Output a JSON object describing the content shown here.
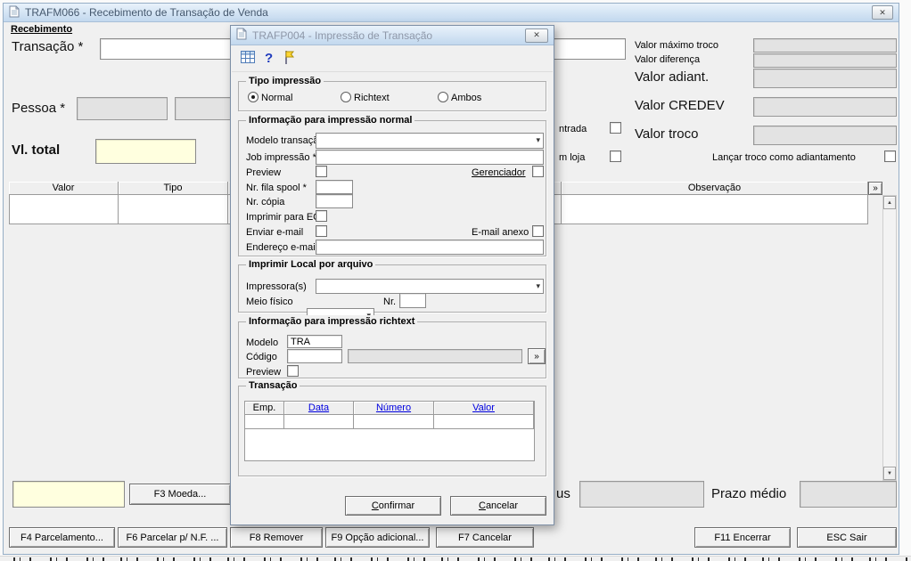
{
  "icons": {
    "close": "✕",
    "dropdown": "▾",
    "scroll_up": "▲",
    "scroll_down": "▼",
    "help": "?"
  },
  "main_window": {
    "title": "TRAFM066 - Recebimento de Transação de Venda",
    "section_label": "Recebimento",
    "fields": {
      "transacao_label": "Transação *",
      "pessoa_label": "Pessoa *",
      "vl_total_label": "Vl. total",
      "valor_maximo_troco_label": "Valor máximo troco",
      "valor_diferenca_label": "Valor diferença",
      "valor_adiant_label": "Valor adiant.",
      "valor_credev_label": "Valor CREDEV",
      "valor_troco_label": "Valor troco",
      "entrada_clipped_label": "ntrada",
      "em_loja_clipped_label": "m loja",
      "lancar_troco_label": "Lançar troco como adiantamento",
      "status_clipped_label": "us",
      "prazo_medio_label": "Prazo médio"
    },
    "table": {
      "columns": [
        "Valor",
        "Tipo",
        "Observação"
      ],
      "expand_button_label": "»"
    },
    "buttons": {
      "f3_moeda": "F3 Moeda...",
      "f4_parcelamento": "F4 Parcelamento...",
      "f6_parcelar": "F6 Parcelar p/ N.F. ...",
      "f8_remover": "F8 Remover",
      "f9_opcao": "F9 Opção adicional...",
      "f7_cancelar": "F7 Cancelar",
      "f11_encerrar": "F11 Encerrar",
      "esc_sair": "ESC Sair"
    }
  },
  "dialog": {
    "title": "TRAFP004 - Impressão de Transação",
    "groups": {
      "tipo_impressao": {
        "legend": "Tipo impressão",
        "radio_normal": "Normal",
        "radio_richtext": "Richtext",
        "radio_ambos": "Ambos",
        "selected_option": "Normal"
      },
      "impressao_normal": {
        "legend": "Informação para impressão normal",
        "modelo_transacao_label": "Modelo transação *",
        "job_impressao_label": "Job impressão *",
        "preview_label": "Preview",
        "gerenciador_label": "Gerenciador",
        "nr_fila_spool_label": "Nr. fila spool *",
        "nr_copia_label": "Nr. cópia",
        "imprimir_ecf_label": "Imprimir para ECF",
        "enviar_email_label": "Enviar e-mail",
        "email_anexo_label": "E-mail anexo",
        "endereco_email_label": "Endereço e-mail"
      },
      "imprimir_local": {
        "legend": "Imprimir Local por arquivo",
        "impressoras_label": "Impressora(s)",
        "meio_fisico_label": "Meio físico",
        "nr_label": "Nr."
      },
      "impressao_richtext": {
        "legend": "Informação para impressão richtext",
        "modelo_label": "Modelo",
        "modelo_value": "TRA",
        "codigo_label": "Código",
        "preview_label": "Preview",
        "expand_button_label": "»"
      },
      "transacao": {
        "legend": "Transação",
        "columns": [
          "Emp.",
          "Data",
          "Número",
          "Valor"
        ]
      }
    },
    "buttons": {
      "confirmar": "Confirmar",
      "cancelar": "Cancelar"
    }
  }
}
